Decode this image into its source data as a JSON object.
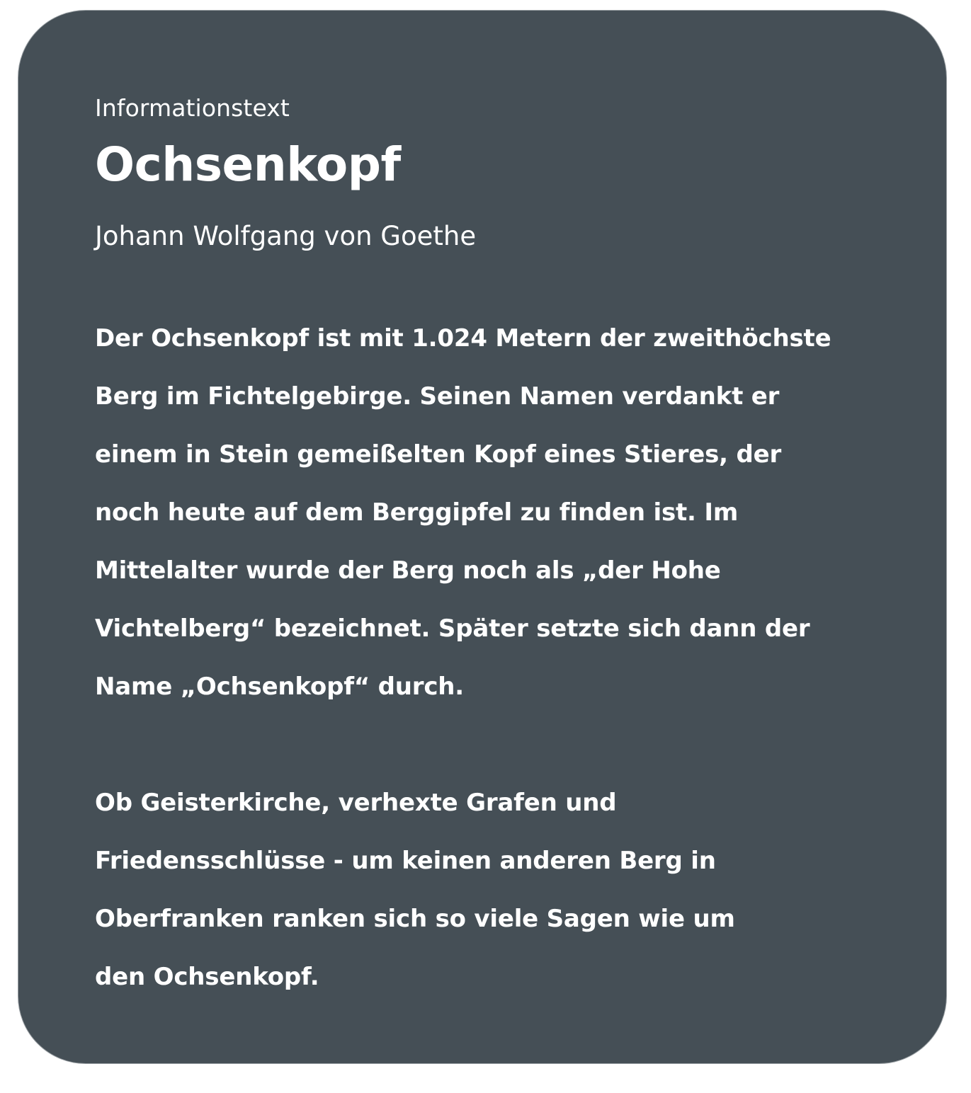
{
  "card": {
    "kicker": "Informationstext",
    "title": "Ochsenkopf",
    "author": "Johann Wolfgang von Goethe",
    "paragraph_1": {
      "lines": [
        "Der Ochsenkopf ist mit 1.024 Metern der zweithöchste",
        "Berg im Fichtelgebirge. Seinen Namen verdankt er",
        "einem in Stein gemeißelten Kopf eines Stieres, der",
        "noch heute auf dem Berggipfel zu finden ist. Im",
        "Mittelalter wurde der Berg noch als „der Hohe",
        "Vichtelberg“ bezeichnet. Später setzte sich dann der",
        "Name „Ochsenkopf“ durch."
      ]
    },
    "paragraph_2": {
      "lines": [
        "Ob Geisterkirche, verhexte Grafen und",
        "Friedensschlüsse - um keinen anderen Berg in",
        "Oberfranken ranken sich so viele Sagen wie um",
        "den Ochsenkopf."
      ]
    }
  },
  "colors": {
    "card_background": "#454f56",
    "card_border": "#9aa0a4",
    "text": "#ffffff",
    "page_background": "#ffffff"
  }
}
